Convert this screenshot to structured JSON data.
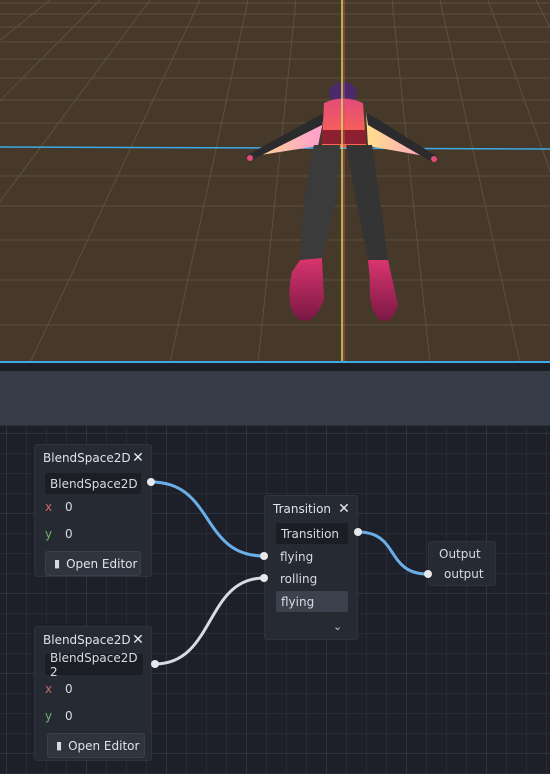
{
  "viewport": {
    "ground_color": "#463929",
    "grid_color": "#6e6350",
    "axis_x_color": "#3fa9e6",
    "axis_y_color": "#cde05a",
    "axis_z_color": "#e04a6a"
  },
  "graph": {
    "nodes": {
      "blendspace1": {
        "title": "BlendSpace2D",
        "field": "BlendSpace2D",
        "x_label": "x",
        "x_value": "0",
        "y_label": "y",
        "y_value": "0",
        "open_editor": "Open Editor"
      },
      "blendspace2": {
        "title": "BlendSpace2D",
        "field": "BlendSpace2D 2",
        "x_label": "x",
        "x_value": "0",
        "y_label": "y",
        "y_value": "0",
        "open_editor": "Open Editor"
      },
      "transition": {
        "title": "Transition",
        "field": "Transition",
        "input_flying": "flying",
        "input_rolling": "rolling",
        "current_state": "flying"
      },
      "output": {
        "title": "Output",
        "port_label": "output"
      }
    },
    "connection_colors": {
      "blend1_to_flying": "#6aaee8",
      "blend2_to_rolling": "#d9dbe0",
      "transition_to_output": "#6aaee8"
    }
  }
}
